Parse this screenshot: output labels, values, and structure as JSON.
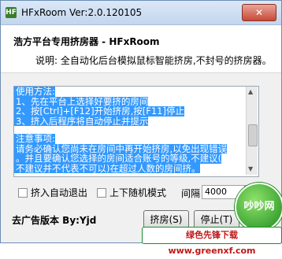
{
  "window": {
    "title": "HFxRoom Ver:2.0.120105",
    "app_icon": "HF",
    "close_label": "✕"
  },
  "header": {
    "title": "浩方平台专用挤房器 - HFxRoom",
    "description": "说明: 全自动化后台模拟鼠标智能挤房,不封号的挤房器。"
  },
  "notes": {
    "lines": [
      "使用方法:",
      "1、先在平台上选择好要挤的房间",
      "2、按[Ctrl]+[F12]开始挤房,按[F11]停止",
      "3、挤入后程序将自动停止并提示",
      "",
      "注意事项:",
      "请务必确认您尚未在房间中再开始挤房,以免出现错误",
      "。并且要确认您选择的房间适合账号的等级,不建议(",
      "不建议并不代表不可以)在超过人数的房间挤。"
    ]
  },
  "options": {
    "auto_exit_label": "挤入自动退出",
    "random_mode_label": "上下随机模式",
    "interval_label": "间隔",
    "interval_value": "4000",
    "interval_unit": "ms"
  },
  "footer": {
    "ad_free_label": "去广告版本 By:Yjd",
    "start_button": "挤房(S)",
    "stop_button": "停止(T)"
  },
  "watermark": {
    "logo_text": "吵吵网",
    "site_text": "绿色先锋下载 www.greenxf.com"
  }
}
